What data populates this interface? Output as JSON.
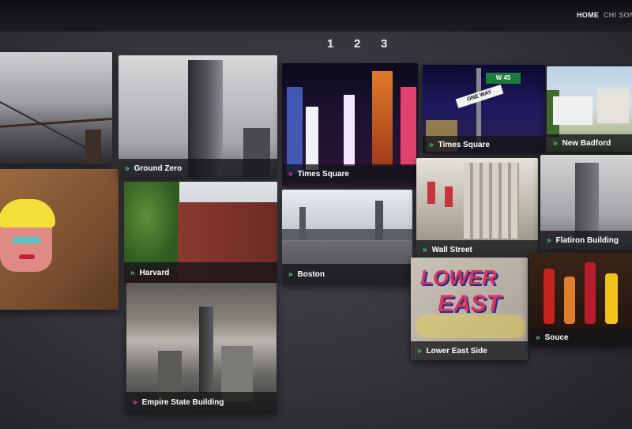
{
  "nav": {
    "home": "HOME",
    "chi_sono": "CHI SONO"
  },
  "pagination": [
    "1",
    "2",
    "3"
  ],
  "accent": {
    "green": "#39d98a",
    "pink": "#ff3f9a"
  },
  "tiles": [
    {
      "caption": "Ground Zero",
      "chevron": "»"
    },
    {
      "caption": "Times Square",
      "chevron": "»"
    },
    {
      "caption": "Times Square",
      "chevron": "»"
    },
    {
      "caption": "New Badford",
      "chevron": "»"
    },
    {
      "caption": "Harvard",
      "chevron": "»"
    },
    {
      "caption": "Boston",
      "chevron": "»"
    },
    {
      "caption": "Wall Street",
      "chevron": "»"
    },
    {
      "caption": "Flatiron Building",
      "chevron": "»"
    },
    {
      "caption": "Empire State Building",
      "chevron": "»"
    },
    {
      "caption": "Lower East Side",
      "chevron": "»"
    },
    {
      "caption": "Souce",
      "chevron": "»"
    }
  ],
  "art": {
    "graffiti_line1": "LOWER",
    "graffiti_line2": "EAST",
    "street_sign": "W 45",
    "one_way": "ONE WAY"
  }
}
